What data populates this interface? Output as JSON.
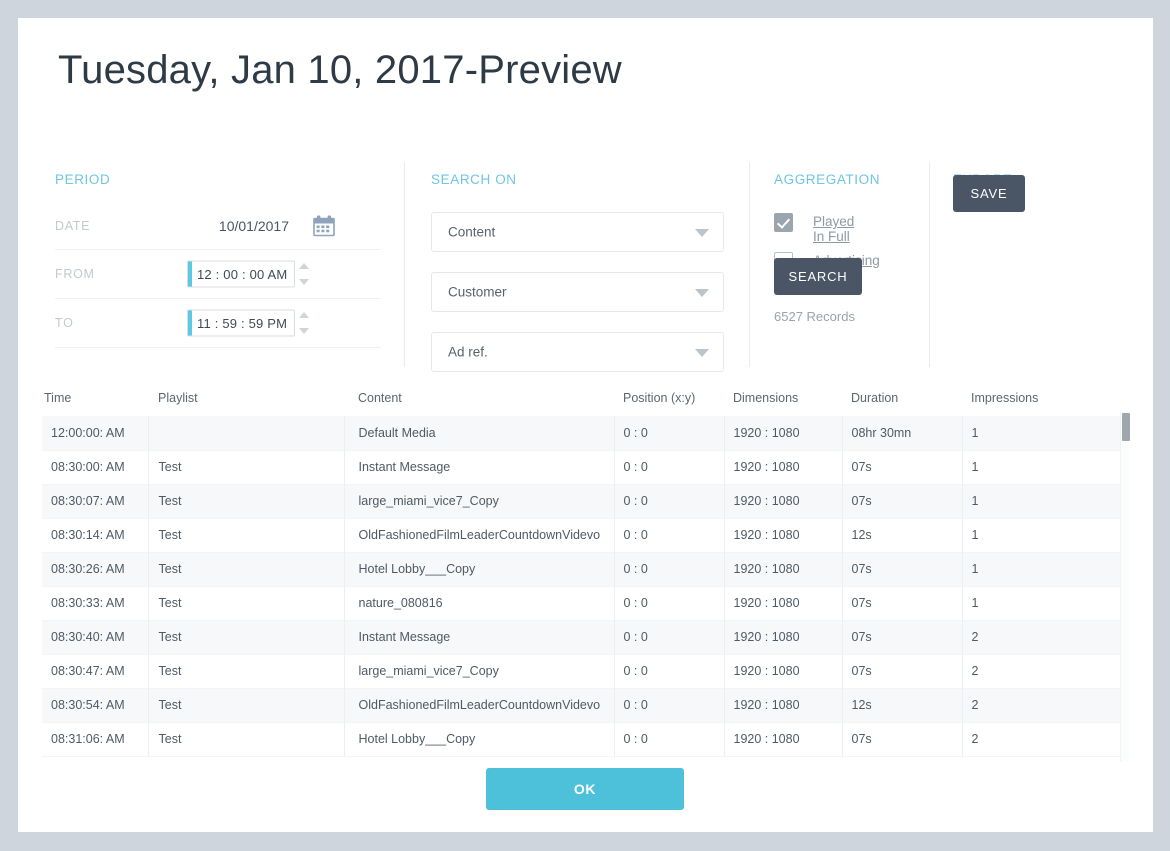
{
  "dialog": {
    "title": "Tuesday, Jan 10, 2017-Preview",
    "ok_label": "OK"
  },
  "period": {
    "section_title": "PERIOD",
    "date_label": "DATE",
    "date_value": "10/01/2017",
    "calendar_icon": "calendar-icon",
    "from_label": "FROM",
    "from_value": "12 : 00 : 00 AM",
    "to_label": "TO",
    "to_value": "11 : 59 : 59 PM"
  },
  "search_on": {
    "section_title": "SEARCH ON",
    "dropdowns": [
      {
        "name": "content",
        "value": "Content"
      },
      {
        "name": "customer",
        "value": "Customer"
      },
      {
        "name": "ad-ref",
        "value": "Ad ref."
      }
    ]
  },
  "aggregation": {
    "section_title": "AGGREGATION",
    "checkboxes": [
      {
        "label": "Played In Full",
        "checked": true
      },
      {
        "label": "Advertising",
        "checked": false
      }
    ],
    "search_label": "SEARCH",
    "records_text": "6527 Records"
  },
  "export": {
    "section_title": "EXPORT",
    "save_label": "SAVE"
  },
  "table": {
    "columns": [
      "Time",
      "Playlist",
      "Content",
      "Position (x:y)",
      "Dimensions",
      "Duration",
      "Impressions"
    ],
    "rows": [
      [
        "12:00:00: AM",
        "",
        "Default Media",
        "0 : 0",
        "1920 : 1080",
        "08hr 30mn",
        "1"
      ],
      [
        "08:30:00: AM",
        "Test",
        "Instant Message",
        "0 : 0",
        "1920 : 1080",
        "07s",
        "1"
      ],
      [
        "08:30:07: AM",
        "Test",
        "large_miami_vice7_Copy",
        "0 : 0",
        "1920 : 1080",
        "07s",
        "1"
      ],
      [
        "08:30:14: AM",
        "Test",
        "OldFashionedFilmLeaderCountdownVidevo",
        "0 : 0",
        "1920 : 1080",
        "12s",
        "1"
      ],
      [
        "08:30:26: AM",
        "Test",
        "Hotel Lobby___Copy",
        "0 : 0",
        "1920 : 1080",
        "07s",
        "1"
      ],
      [
        "08:30:33: AM",
        "Test",
        "nature_080816",
        "0 : 0",
        "1920 : 1080",
        "07s",
        "1"
      ],
      [
        "08:30:40: AM",
        "Test",
        "Instant Message",
        "0 : 0",
        "1920 : 1080",
        "07s",
        "2"
      ],
      [
        "08:30:47: AM",
        "Test",
        "large_miami_vice7_Copy",
        "0 : 0",
        "1920 : 1080",
        "07s",
        "2"
      ],
      [
        "08:30:54: AM",
        "Test",
        "OldFashionedFilmLeaderCountdownVidevo",
        "0 : 0",
        "1920 : 1080",
        "12s",
        "2"
      ],
      [
        "08:31:06: AM",
        "Test",
        "Hotel Lobby___Copy",
        "0 : 0",
        "1920 : 1080",
        "07s",
        "2"
      ]
    ]
  },
  "colors": {
    "accent": "#4ec1da",
    "section_heading": "#6ec6e0",
    "dark_button": "#4a5665",
    "page_background": "#ced5dd"
  }
}
